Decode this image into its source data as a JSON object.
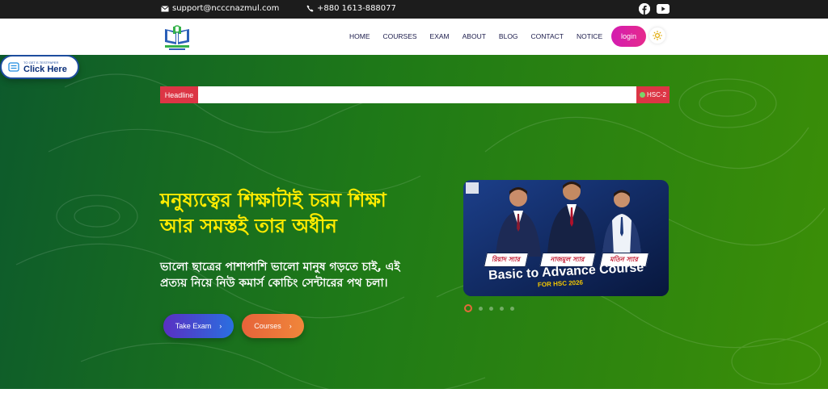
{
  "topbar": {
    "email": "support@ncccnazmul.com",
    "phone": "+880 1613-888077",
    "social": [
      "facebook-icon",
      "youtube-icon"
    ]
  },
  "navbar": {
    "menu": [
      "HOME",
      "COURSES",
      "EXAM",
      "ABOUT",
      "BLOG",
      "CONTACT",
      "NOTICE"
    ],
    "login_label": "login",
    "theme_icon": "sun-icon"
  },
  "ticker": {
    "label": "Headline",
    "item": "HSC-2"
  },
  "hero": {
    "title_line1": "মনুষ্যত্বের শিক্ষাটাই চরম শিক্ষা",
    "title_line2": "আর সমস্তই তার অধীন",
    "subtitle_line1": "ভালো ছাত্রের পাশাপাশি ভালো মানুষ গড়তে চাই, এই",
    "subtitle_line2": "প্রত্যয় নিয়ে নিউ কমার্স কোচিং সেন্টারের পথ চলা।",
    "btn_exam": "Take Exam",
    "btn_courses": "Courses",
    "click_small": "TO GET E-TESTPAPER",
    "click_big": "Click Here"
  },
  "banner": {
    "names": [
      "রিয়াদ স্যার",
      "নাজমুল স্যার",
      "মতিন স্যার"
    ],
    "title": "Basic to Advance  Course",
    "subtitle": "FOR HSC 2026",
    "slide_count": 5,
    "active_slide": 1
  },
  "colors": {
    "headline_yellow": "#ffeb00",
    "ticker_red": "#dc3545",
    "login_pink": "#d31cb0",
    "hero_green": "#1f7a17"
  }
}
